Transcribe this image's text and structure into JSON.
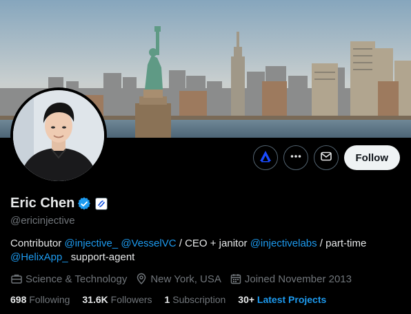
{
  "profile": {
    "name": "Eric Chen",
    "handle": "@ericinjective",
    "bio": {
      "t1": "Contributor ",
      "l1": "@injective_",
      "t2": " ",
      "l2": "@VesselVC",
      "t3": " / CEO + janitor ",
      "l3": "@injectivelabs",
      "t4": " / part-time ",
      "l4": "@HelixApp_",
      "t5": " support-agent"
    },
    "category": "Science & Technology",
    "location": "New York, USA",
    "joined": "Joined November 2013"
  },
  "actions": {
    "follow_label": "Follow"
  },
  "stats": {
    "following_count": "698",
    "following_label": " Following",
    "followers_count": "31.6K",
    "followers_label": " Followers",
    "subscription_count": "1",
    "subscription_label": " Subscription",
    "projects_count": "30+",
    "projects_label": "Latest Projects"
  },
  "colors": {
    "accent": "#1d9bf0",
    "background": "#000000",
    "follow_button": "#eff3f4"
  },
  "icons": [
    "verified-badge-icon",
    "affiliate-badge-icon",
    "grok-logo-icon",
    "more-icon",
    "mail-icon",
    "briefcase-icon",
    "location-icon",
    "calendar-icon"
  ]
}
